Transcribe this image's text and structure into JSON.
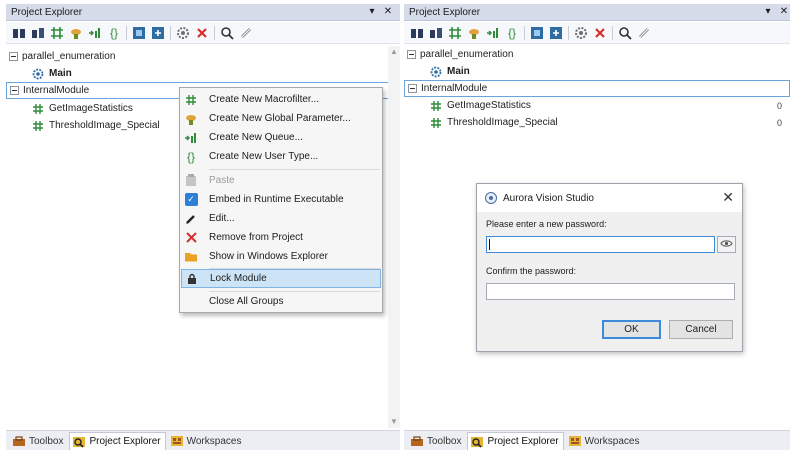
{
  "left_panel": {
    "title": "Project Explorer",
    "title_controls": [
      "▾",
      "✕"
    ],
    "tree": [
      {
        "label": "parallel_enumeration",
        "kind": "program"
      },
      {
        "label": "Main",
        "kind": "macro"
      },
      {
        "label": "InternalModule",
        "kind": "module"
      },
      {
        "label": "GetImageStatistics",
        "kind": "macrofilter"
      },
      {
        "label": "ThresholdImage_Special",
        "kind": "macrofilter"
      }
    ],
    "bottom_tabs": [
      "Toolbox",
      "Project Explorer",
      "Workspaces"
    ]
  },
  "context_menu": {
    "items": [
      {
        "label": "Create New Macrofilter...",
        "icon": "macrofilter-icon",
        "disabled": false
      },
      {
        "label": "Create New Global Parameter...",
        "icon": "global-parameter-icon",
        "disabled": false
      },
      {
        "label": "Create New Queue...",
        "icon": "queue-icon",
        "disabled": false
      },
      {
        "label": "Create New User Type...",
        "icon": "user-type-icon",
        "disabled": false
      },
      {
        "label": "Paste",
        "icon": "paste-icon",
        "disabled": true
      },
      {
        "label": "Embed in Runtime Executable",
        "icon": "check-icon",
        "disabled": false
      },
      {
        "label": "Edit...",
        "icon": "pencil-icon",
        "disabled": false
      },
      {
        "label": "Remove from Project",
        "icon": "red-x-icon",
        "disabled": false
      },
      {
        "label": "Show in Windows Explorer",
        "icon": "folder-icon",
        "disabled": false
      },
      {
        "label": "Lock Module",
        "icon": "lock-icon",
        "disabled": false
      },
      {
        "label": "Close All Groups",
        "icon": "",
        "disabled": false
      }
    ]
  },
  "right_panel": {
    "title": "Project Explorer",
    "title_controls": [
      "▾",
      "✕"
    ],
    "tree": [
      {
        "label": "parallel_enumeration",
        "kind": "program"
      },
      {
        "label": "Main",
        "kind": "macro"
      },
      {
        "label": "InternalModule",
        "kind": "module"
      },
      {
        "label": "GetImageStatistics",
        "kind": "macrofilter",
        "count": "0"
      },
      {
        "label": "ThresholdImage_Special",
        "kind": "macrofilter",
        "count": "0"
      }
    ],
    "bottom_tabs": [
      "Toolbox",
      "Project Explorer",
      "Workspaces"
    ]
  },
  "dialog": {
    "title": "Aurora Vision Studio",
    "close": "✕",
    "label_new": "Please enter a new password:",
    "label_confirm": "Confirm the password:",
    "ok": "OK",
    "cancel": "Cancel"
  },
  "colors": {
    "titlebar": "#d6dbe9",
    "selection_border": "#6aa4d8",
    "menu_highlight": "#cde4f7",
    "accent_blue": "#2d7fd6",
    "remove_red": "#d32f2f"
  }
}
